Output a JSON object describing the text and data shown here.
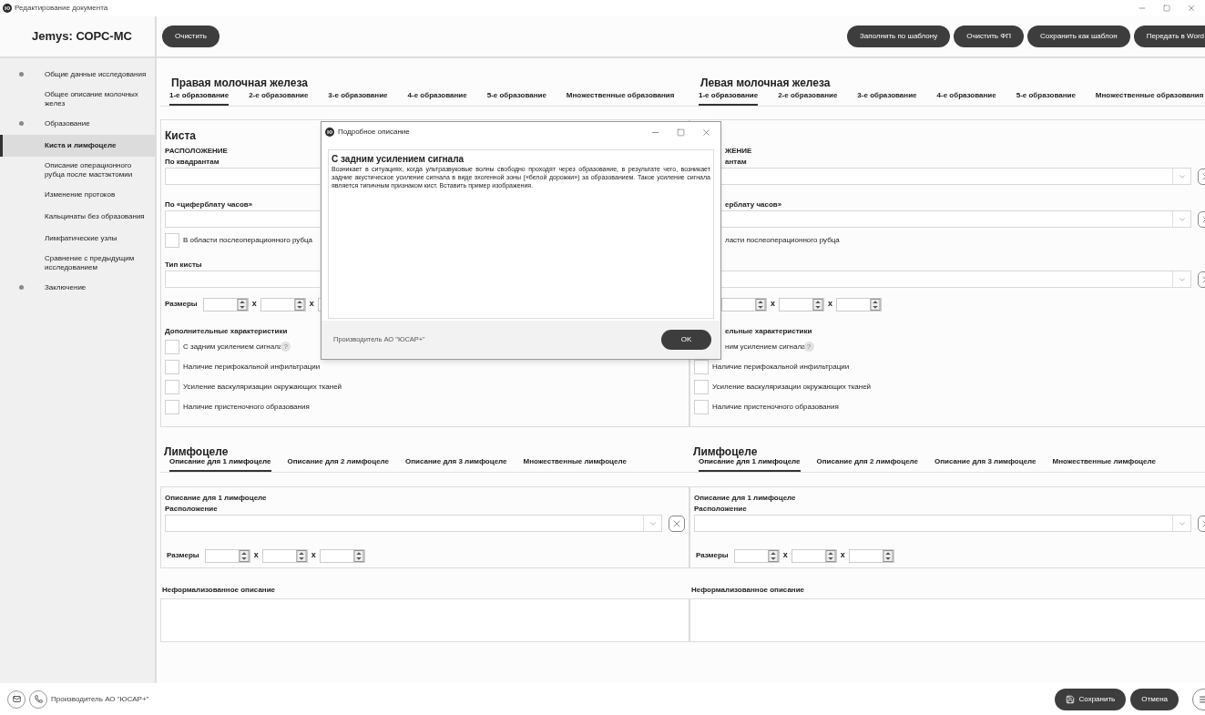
{
  "window": {
    "title": "Редактирование документа"
  },
  "sidebar": {
    "title": "Jemys: СОРС-МС",
    "items": [
      {
        "label": "Общие данные исследования",
        "kind": "section",
        "selected": false
      },
      {
        "label": "Общее описание молочных желез",
        "kind": "item",
        "selected": false
      },
      {
        "label": "Образование",
        "kind": "section",
        "selected": false
      },
      {
        "label": "Киста и лимфоцеле",
        "kind": "item",
        "selected": true
      },
      {
        "label": "Описание операционного рубца после мастэктомии",
        "kind": "item",
        "selected": false
      },
      {
        "label": "Изменение протоков",
        "kind": "item",
        "selected": false
      },
      {
        "label": "Кальцинаты без образования",
        "kind": "item",
        "selected": false
      },
      {
        "label": "Лимфатические узлы",
        "kind": "item",
        "selected": false
      },
      {
        "label": "Сравнение с предыдущим исследованием",
        "kind": "item",
        "selected": false
      },
      {
        "label": "Заключение",
        "kind": "section",
        "selected": false
      }
    ]
  },
  "toolbar": {
    "left_buttons": [
      "Очистить"
    ],
    "right_buttons": [
      "Заполнить по шаблону",
      "Очистить ФП",
      "Сохранить как шаблон",
      "Передать в Word"
    ]
  },
  "panels": [
    {
      "title": "Правая молочная железа",
      "tabs": [
        {
          "label": "1-е образование",
          "selected": true
        },
        {
          "label": "2-е образование",
          "selected": false
        },
        {
          "label": "3-е образование",
          "selected": false
        },
        {
          "label": "4-е образование",
          "selected": false
        },
        {
          "label": "5-е образование",
          "selected": false
        },
        {
          "label": "Множественные образования",
          "selected": false
        }
      ],
      "cyst": {
        "title": "Киста",
        "location_heading": "РАСПОЛОЖЕНИЕ",
        "quadrants_label": "По квадрантам",
        "clock_label": "По «циферблату часов»",
        "scar": {
          "label": "В области послеоперационного рубца",
          "checked": false
        },
        "type_label": "Тип кисты",
        "sizes_label": "Размеры",
        "times": [
          "x",
          "x"
        ],
        "extra_heading": "Дополнительные характеристики",
        "extras": [
          {
            "label": "С задним усилением сигнала",
            "checked": false,
            "help": "?"
          },
          {
            "label": "Наличие перифокальной инфильтрации",
            "checked": false
          },
          {
            "label": "Усиление васкуляризации окружающих тканей",
            "checked": false
          },
          {
            "label": "Наличие пристеночного образования",
            "checked": false
          }
        ]
      },
      "lymphocele": {
        "title": "Лимфоцеле",
        "tabs": [
          {
            "label": "Описание для 1 лимфоцеле",
            "selected": true
          },
          {
            "label": "Описание для 2 лимфоцеле",
            "selected": false
          },
          {
            "label": "Описание для 3 лимфоцеле",
            "selected": false
          },
          {
            "label": "Множественные лимфоцеле",
            "selected": false
          }
        ],
        "card_title": "Описание для 1 лимфоцеле",
        "location_label": "Расположение",
        "sizes_label": "Размеры",
        "times": [
          "x",
          "x"
        ]
      },
      "notes_label": "Неформализованное описание"
    },
    {
      "title": "Левая молочная железа",
      "tabs": [
        {
          "label": "1-е образование",
          "selected": true
        },
        {
          "label": "2-е образование",
          "selected": false
        },
        {
          "label": "3-е образование",
          "selected": false
        },
        {
          "label": "4-е образование",
          "selected": false
        },
        {
          "label": "5-е образование",
          "selected": false
        },
        {
          "label": "Множественные образования",
          "selected": false
        }
      ],
      "cyst": {
        "location_heading": "ЖЕНИЕ",
        "quadrants_label": "антам",
        "clock_label": "ерблату часов»",
        "scar": {
          "label": "ласти послеоперационного рубца"
        },
        "times": [
          "x",
          "x"
        ],
        "extra_heading": "ельные характеристики",
        "extras": [
          {
            "label": "ним усилением сигнала",
            "help": "?"
          },
          {
            "label": "Наличие перифокальной инфильтрации",
            "checked": false
          },
          {
            "label": "Усиление васкуляризации окружающих тканей",
            "checked": false
          },
          {
            "label": "Наличие пристеночного образования",
            "checked": false
          }
        ]
      },
      "lymphocele": {
        "title": "Лимфоцеле",
        "tabs": [
          {
            "label": "Описание для 1 лимфоцеле",
            "selected": true
          },
          {
            "label": "Описание для 2 лимфоцеле",
            "selected": false
          },
          {
            "label": "Описание для 3 лимфоцеле",
            "selected": false
          },
          {
            "label": "Множественные лимфоцеле",
            "selected": false
          }
        ],
        "card_title": "Описание для 1 лимфоцеле",
        "location_label": "Расположение",
        "sizes_label": "Размеры",
        "times": [
          "x",
          "x"
        ]
      },
      "notes_label": "Неформализованное описание"
    }
  ],
  "dialog": {
    "title": "Подробное описание",
    "heading": "С задним усилением сигнала",
    "body": "Возникает в ситуациях, когда ультразвуковые волны свободно проходят через образование, в результате чего, возникает задние акустическое усиление сигнала в виде эхогенной зоны («белой дорожки») за образованием. Такое усиление сигнала является типичным признаком кист. Вставить пример изображения.",
    "producer": "Производитель АО \"ЮСАР+\"",
    "ok": "OK"
  },
  "footer": {
    "producer": "Производитель АО \"ЮСАР+\"",
    "save": "Сохранить",
    "cancel": "Отмена"
  }
}
